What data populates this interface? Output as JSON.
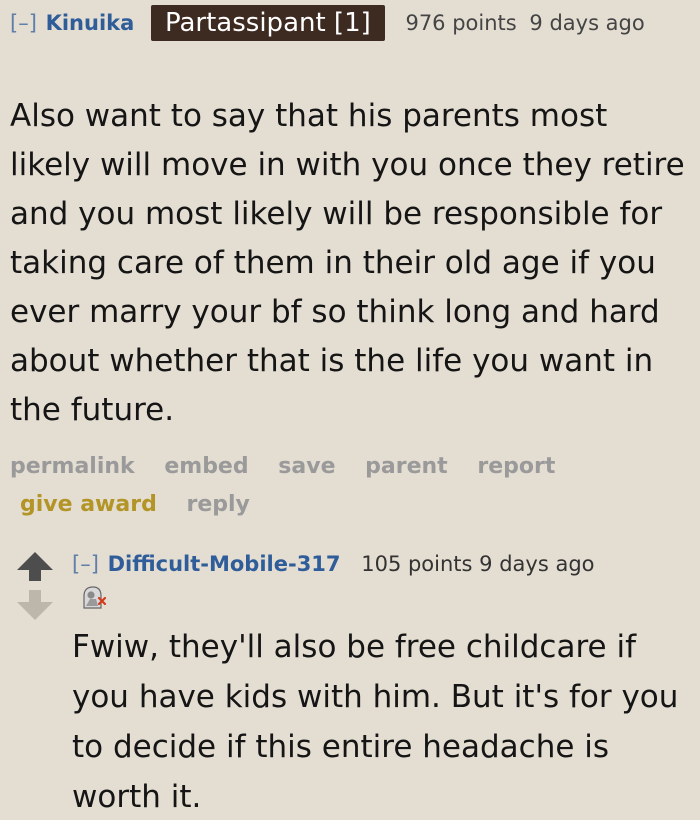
{
  "comment": {
    "expand_toggle": "[–]",
    "author": "Kinuika",
    "flair": "Partassipant [1]",
    "score": "976 points",
    "time": "9 days ago",
    "body": "Also want to say that his parents most likely will move in with you once they retire and you most likely will be responsible for taking care of them in their old age if you ever marry your bf so think long and hard about whether that is the life you want in the future.",
    "buttons": {
      "permalink": "permalink",
      "embed": "embed",
      "save": "save",
      "parent": "parent",
      "report": "report",
      "give_award": "give award",
      "reply": "reply"
    }
  },
  "child": {
    "expand_toggle": "[–]",
    "author": "Difficult-Mobile-317",
    "score": "105 points",
    "time": "9 days ago",
    "award_icon": "award-badge-icon",
    "body": "Fwiw, they'll also be free childcare if you have kids with him. But it's for you to decide if this entire headache is worth it."
  },
  "colors": {
    "background": "#e4ddd2",
    "author_link": "#2f5d9a",
    "flair_bg": "#3d2a20",
    "button_gray": "#9a9a9a",
    "give_award_gold": "#b39426"
  }
}
